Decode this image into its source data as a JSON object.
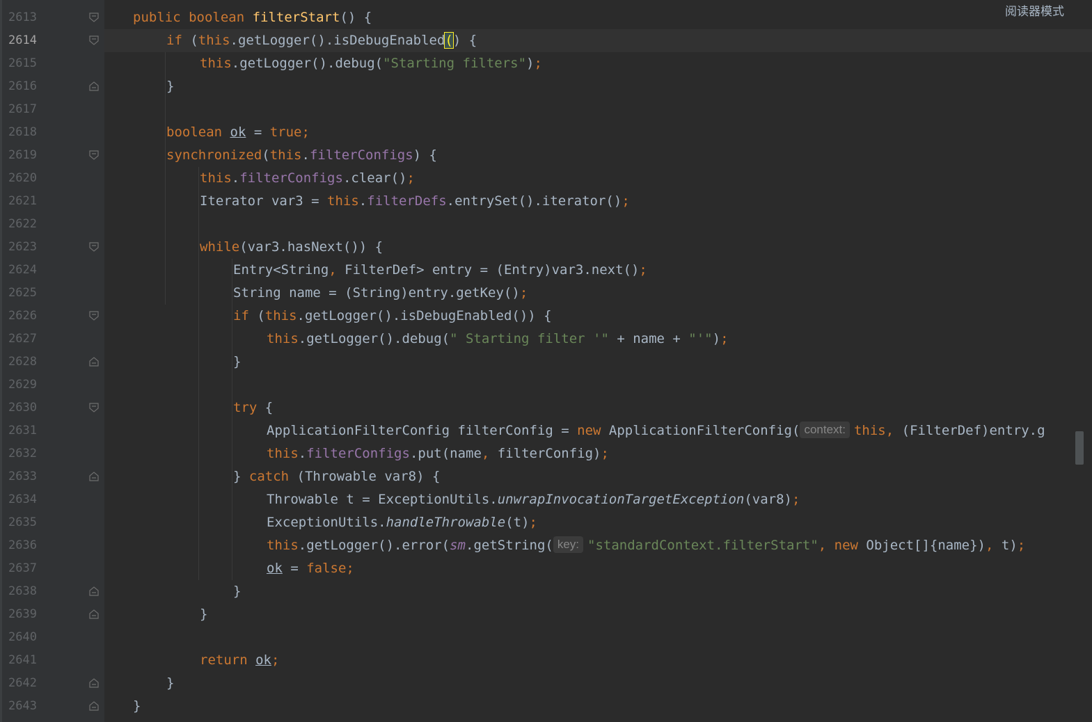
{
  "header": {
    "reader_mode_label": "阅读器模式"
  },
  "editor": {
    "current_line": "2614",
    "lines": [
      {
        "num": "2613",
        "fold": "open",
        "indent": 1,
        "tokens": [
          [
            "kw",
            "public "
          ],
          [
            "kw",
            "boolean "
          ],
          [
            "fn",
            "filterStart"
          ],
          [
            "",
            "() {"
          ]
        ]
      },
      {
        "num": "2614",
        "fold": "open",
        "indent": 2,
        "tokens": [
          [
            "kw",
            "if "
          ],
          [
            "",
            "("
          ],
          [
            "kw",
            "this"
          ],
          [
            "",
            ".getLogger().isDebugEnabled"
          ],
          [
            "hl",
            "("
          ],
          [
            "",
            ") {"
          ]
        ]
      },
      {
        "num": "2615",
        "fold": "",
        "indent": 3,
        "tokens": [
          [
            "kw",
            "this"
          ],
          [
            "",
            ".getLogger().debug("
          ],
          [
            "str",
            "\"Starting filters\""
          ],
          [
            "",
            ")"
          ],
          [
            "kw",
            ";"
          ]
        ]
      },
      {
        "num": "2616",
        "fold": "close",
        "indent": 2,
        "tokens": [
          [
            "",
            "}"
          ]
        ]
      },
      {
        "num": "2617",
        "fold": "",
        "indent": 2,
        "tokens": []
      },
      {
        "num": "2618",
        "fold": "",
        "indent": 2,
        "tokens": [
          [
            "kw",
            "boolean "
          ],
          [
            "ul",
            "ok"
          ],
          [
            "",
            " = "
          ],
          [
            "kw",
            "true;"
          ]
        ]
      },
      {
        "num": "2619",
        "fold": "open",
        "indent": 2,
        "tokens": [
          [
            "kw",
            "synchronized"
          ],
          [
            "",
            "("
          ],
          [
            "kw",
            "this"
          ],
          [
            "",
            "."
          ],
          [
            "fld",
            "filterConfigs"
          ],
          [
            "",
            ") {"
          ]
        ]
      },
      {
        "num": "2620",
        "fold": "",
        "indent": 3,
        "tokens": [
          [
            "kw",
            "this"
          ],
          [
            "",
            "."
          ],
          [
            "fld",
            "filterConfigs"
          ],
          [
            "",
            ".clear()"
          ],
          [
            "kw",
            ";"
          ]
        ]
      },
      {
        "num": "2621",
        "fold": "",
        "indent": 3,
        "tokens": [
          [
            "",
            "Iterator var3 = "
          ],
          [
            "kw",
            "this"
          ],
          [
            "",
            "."
          ],
          [
            "fld",
            "filterDefs"
          ],
          [
            "",
            ".entrySet().iterator()"
          ],
          [
            "kw",
            ";"
          ]
        ]
      },
      {
        "num": "2622",
        "fold": "",
        "indent": 3,
        "tokens": []
      },
      {
        "num": "2623",
        "fold": "open",
        "indent": 3,
        "tokens": [
          [
            "kw",
            "while"
          ],
          [
            "",
            "(var3.hasNext()) {"
          ]
        ]
      },
      {
        "num": "2624",
        "fold": "",
        "indent": 4,
        "tokens": [
          [
            "",
            "Entry<String"
          ],
          [
            "kw",
            ", "
          ],
          [
            "",
            "FilterDef> entry = (Entry)var3.next()"
          ],
          [
            "kw",
            ";"
          ]
        ]
      },
      {
        "num": "2625",
        "fold": "",
        "indent": 4,
        "tokens": [
          [
            "",
            "String name = (String)entry.getKey()"
          ],
          [
            "kw",
            ";"
          ]
        ]
      },
      {
        "num": "2626",
        "fold": "open",
        "indent": 4,
        "tokens": [
          [
            "kw",
            "if "
          ],
          [
            "",
            "("
          ],
          [
            "kw",
            "this"
          ],
          [
            "",
            ".getLogger().isDebugEnabled()) {"
          ]
        ]
      },
      {
        "num": "2627",
        "fold": "",
        "indent": 5,
        "tokens": [
          [
            "kw",
            "this"
          ],
          [
            "",
            ".getLogger().debug("
          ],
          [
            "str",
            "\" Starting filter '\""
          ],
          [
            "",
            " + name + "
          ],
          [
            "str",
            "\"'\""
          ],
          [
            "",
            ")"
          ],
          [
            "kw",
            ";"
          ]
        ]
      },
      {
        "num": "2628",
        "fold": "close",
        "indent": 4,
        "tokens": [
          [
            "",
            "}"
          ]
        ]
      },
      {
        "num": "2629",
        "fold": "",
        "indent": 4,
        "tokens": []
      },
      {
        "num": "2630",
        "fold": "open",
        "indent": 4,
        "tokens": [
          [
            "kw",
            "try "
          ],
          [
            "",
            "{"
          ]
        ]
      },
      {
        "num": "2631",
        "fold": "",
        "indent": 5,
        "tokens": [
          [
            "",
            "ApplicationFilterConfig filterConfig = "
          ],
          [
            "kw",
            "new "
          ],
          [
            "",
            "ApplicationFilterConfig("
          ],
          [
            "hint",
            "context:"
          ],
          [
            "kw",
            "this, "
          ],
          [
            "",
            "(FilterDef)entry.g"
          ]
        ]
      },
      {
        "num": "2632",
        "fold": "",
        "indent": 5,
        "tokens": [
          [
            "kw",
            "this"
          ],
          [
            "",
            "."
          ],
          [
            "fld",
            "filterConfigs"
          ],
          [
            "",
            ".put(name"
          ],
          [
            "kw",
            ", "
          ],
          [
            "",
            "filterConfig)"
          ],
          [
            "kw",
            ";"
          ]
        ]
      },
      {
        "num": "2633",
        "fold": "close",
        "indent": 4,
        "tokens": [
          [
            "",
            "} "
          ],
          [
            "kw",
            "catch "
          ],
          [
            "",
            "(Throwable var8) {"
          ]
        ]
      },
      {
        "num": "2634",
        "fold": "",
        "indent": 5,
        "tokens": [
          [
            "",
            "Throwable t = ExceptionUtils."
          ],
          [
            "it",
            "unwrapInvocationTargetException"
          ],
          [
            "",
            "(var8)"
          ],
          [
            "kw",
            ";"
          ]
        ]
      },
      {
        "num": "2635",
        "fold": "",
        "indent": 5,
        "tokens": [
          [
            "",
            "ExceptionUtils."
          ],
          [
            "it",
            "handleThrowable"
          ],
          [
            "",
            "(t)"
          ],
          [
            "kw",
            ";"
          ]
        ]
      },
      {
        "num": "2636",
        "fold": "",
        "indent": 5,
        "tokens": [
          [
            "kw",
            "this"
          ],
          [
            "",
            ".getLogger().error("
          ],
          [
            "itf",
            "sm"
          ],
          [
            "",
            ".getString("
          ],
          [
            "hint",
            "key:"
          ],
          [
            "str",
            "\"standardContext.filterStart\""
          ],
          [
            "kw",
            ", new "
          ],
          [
            "",
            "Object[]{name})"
          ],
          [
            "kw",
            ", "
          ],
          [
            "",
            "t)"
          ],
          [
            "kw",
            ";"
          ]
        ]
      },
      {
        "num": "2637",
        "fold": "",
        "indent": 5,
        "tokens": [
          [
            "ul",
            "ok"
          ],
          [
            "",
            " = "
          ],
          [
            "kw",
            "false;"
          ]
        ]
      },
      {
        "num": "2638",
        "fold": "close",
        "indent": 4,
        "tokens": [
          [
            "",
            "}"
          ]
        ]
      },
      {
        "num": "2639",
        "fold": "close",
        "indent": 3,
        "tokens": [
          [
            "",
            "}"
          ]
        ]
      },
      {
        "num": "2640",
        "fold": "",
        "indent": 3,
        "tokens": []
      },
      {
        "num": "2641",
        "fold": "",
        "indent": 3,
        "tokens": [
          [
            "kw",
            "return "
          ],
          [
            "ul",
            "ok"
          ],
          [
            "kw",
            ";"
          ]
        ]
      },
      {
        "num": "2642",
        "fold": "close",
        "indent": 2,
        "tokens": [
          [
            "",
            "}"
          ]
        ]
      },
      {
        "num": "2643",
        "fold": "close",
        "indent": 1,
        "tokens": [
          [
            "",
            "}"
          ]
        ]
      }
    ]
  },
  "colors": {
    "background": "#2b2b2b",
    "keyword": "#cc7832",
    "method_decl": "#ffc66d",
    "field": "#9876aa",
    "string": "#6a8759",
    "text": "#a9b7c6",
    "line_number": "#606366"
  }
}
